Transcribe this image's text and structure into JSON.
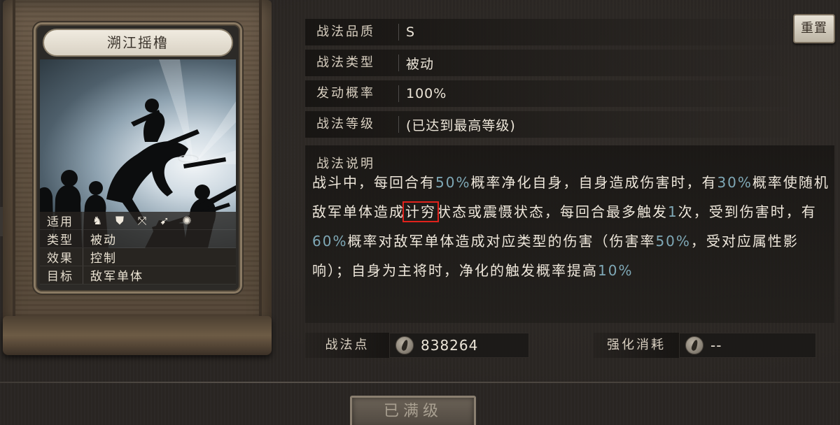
{
  "card": {
    "title": "溯江摇橹",
    "info": [
      {
        "key": "适用",
        "value": ""
      },
      {
        "key": "类型",
        "value": "被动"
      },
      {
        "key": "效果",
        "value": "控制"
      },
      {
        "key": "目标",
        "value": "敌军单体"
      }
    ],
    "troop_icons": [
      "cavalry-icon",
      "shield-icon",
      "bow-icon",
      "spear-icon",
      "siege-wheel-icon"
    ]
  },
  "attributes": [
    {
      "label": "战法品质",
      "value": "S"
    },
    {
      "label": "战法类型",
      "value": "被动"
    },
    {
      "label": "发动概率",
      "value": "100%"
    },
    {
      "label": "战法等级",
      "value": "(已达到最高等级)"
    }
  ],
  "reset_label": "重置",
  "description": {
    "title": "战法说明",
    "segments": [
      {
        "text": "战斗中，每回合有",
        "style": "normal"
      },
      {
        "text": "50%",
        "style": "hl"
      },
      {
        "text": "概率净化自身，自身造成伤害时，有",
        "style": "normal"
      },
      {
        "text": "30%",
        "style": "hl"
      },
      {
        "text": "概率使随机敌军单体造成",
        "style": "normal"
      },
      {
        "text": "计穷",
        "style": "boxed"
      },
      {
        "text": "状态或震慑状态，每回合最多触发",
        "style": "normal"
      },
      {
        "text": "1",
        "style": "hl"
      },
      {
        "text": "次，受到伤害时，有",
        "style": "normal"
      },
      {
        "text": "60%",
        "style": "hl"
      },
      {
        "text": "概率对敌军单体造成对应类型的伤害（伤害率",
        "style": "normal"
      },
      {
        "text": "50%",
        "style": "hl"
      },
      {
        "text": "，受对应属性影响）；自身为主将时，净化的触发概率提高",
        "style": "normal"
      },
      {
        "text": "10%",
        "style": "hl"
      }
    ]
  },
  "tactic_points": {
    "label": "战法点",
    "value": "838264"
  },
  "upgrade_cost": {
    "label": "强化消耗",
    "value": "--"
  },
  "max_level_button": "已满级",
  "side_arrow": "‹"
}
